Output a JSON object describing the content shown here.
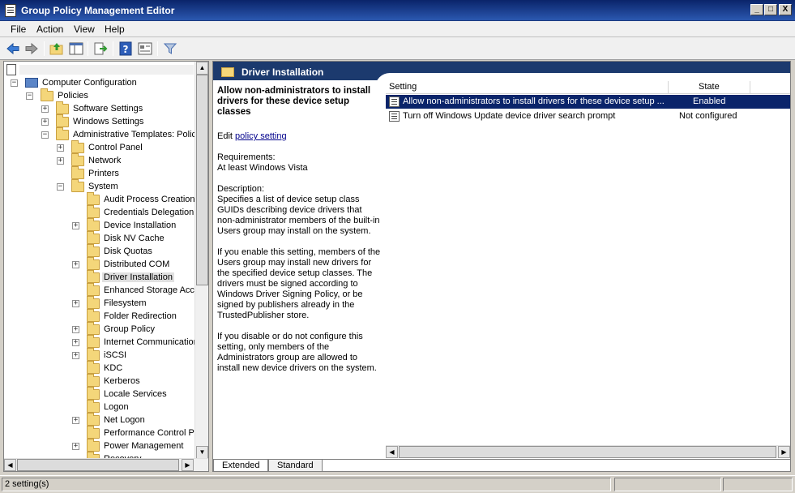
{
  "window": {
    "title": "Group Policy Management Editor",
    "minimize": "_",
    "maximize": "□",
    "close": "X"
  },
  "menu": [
    "File",
    "Action",
    "View",
    "Help"
  ],
  "toolbar": {
    "buttons": [
      "back-icon",
      "forward-icon",
      "up-folder-icon",
      "show-hide-tree-icon",
      "export-list-icon",
      "help-icon",
      "properties-icon",
      "filter-icon"
    ]
  },
  "tree": {
    "root_label": "",
    "items": [
      {
        "label": "Computer Configuration",
        "expander": "−"
      },
      {
        "label": "Policies",
        "expander": "−"
      },
      {
        "label": "Software Settings",
        "expander": "+"
      },
      {
        "label": "Windows Settings",
        "expander": "+"
      },
      {
        "label": "Administrative Templates: Policy",
        "expander": "−"
      },
      {
        "label": "Control Panel",
        "expander": "+"
      },
      {
        "label": "Network",
        "expander": "+"
      },
      {
        "label": "Printers",
        "expander": ""
      },
      {
        "label": "System",
        "expander": "−"
      },
      {
        "label": "Audit Process Creation",
        "expander": ""
      },
      {
        "label": "Credentials Delegation",
        "expander": ""
      },
      {
        "label": "Device Installation",
        "expander": "+"
      },
      {
        "label": "Disk NV Cache",
        "expander": ""
      },
      {
        "label": "Disk Quotas",
        "expander": ""
      },
      {
        "label": "Distributed COM",
        "expander": "+"
      },
      {
        "label": "Driver Installation",
        "expander": "",
        "selected": true
      },
      {
        "label": "Enhanced Storage Acces",
        "expander": ""
      },
      {
        "label": "Filesystem",
        "expander": "+"
      },
      {
        "label": "Folder Redirection",
        "expander": ""
      },
      {
        "label": "Group Policy",
        "expander": "+"
      },
      {
        "label": "Internet Communication",
        "expander": "+"
      },
      {
        "label": "iSCSI",
        "expander": "+"
      },
      {
        "label": "KDC",
        "expander": ""
      },
      {
        "label": "Kerberos",
        "expander": ""
      },
      {
        "label": "Locale Services",
        "expander": ""
      },
      {
        "label": "Logon",
        "expander": ""
      },
      {
        "label": "Net Logon",
        "expander": "+"
      },
      {
        "label": "Performance Control Par",
        "expander": ""
      },
      {
        "label": "Power Management",
        "expander": "+"
      },
      {
        "label": "Recovery",
        "expander": ""
      }
    ]
  },
  "right": {
    "header_title": "Driver Installation",
    "setting_title": "Allow non-administrators to install drivers for these device setup classes",
    "edit_prefix": "Edit ",
    "edit_link": "policy setting ",
    "requirements_label": "Requirements:",
    "requirements_value": "At least Windows Vista",
    "description_label": "Description:",
    "description_1": "Specifies a list of device setup class GUIDs describing device drivers that non-administrator members of the built-in Users group may install on the system.",
    "description_2": "If you enable this setting, members of the Users group may install new drivers for the specified device setup classes. The drivers must be signed according to Windows Driver Signing Policy, or be signed by publishers already in the TrustedPublisher store.",
    "description_3": "If you disable or do not configure this setting, only members of the Administrators group are allowed to install new device drivers on the system."
  },
  "list": {
    "columns": {
      "setting": "Setting",
      "state": "State"
    },
    "rows": [
      {
        "setting": "Allow non-administrators to install drivers for these device setup ...",
        "state": "Enabled",
        "selected": true
      },
      {
        "setting": "Turn off Windows Update device driver search prompt",
        "state": "Not configured",
        "selected": false
      }
    ]
  },
  "tabs": [
    "Extended",
    "Standard"
  ],
  "status": {
    "text": "2 setting(s)"
  }
}
